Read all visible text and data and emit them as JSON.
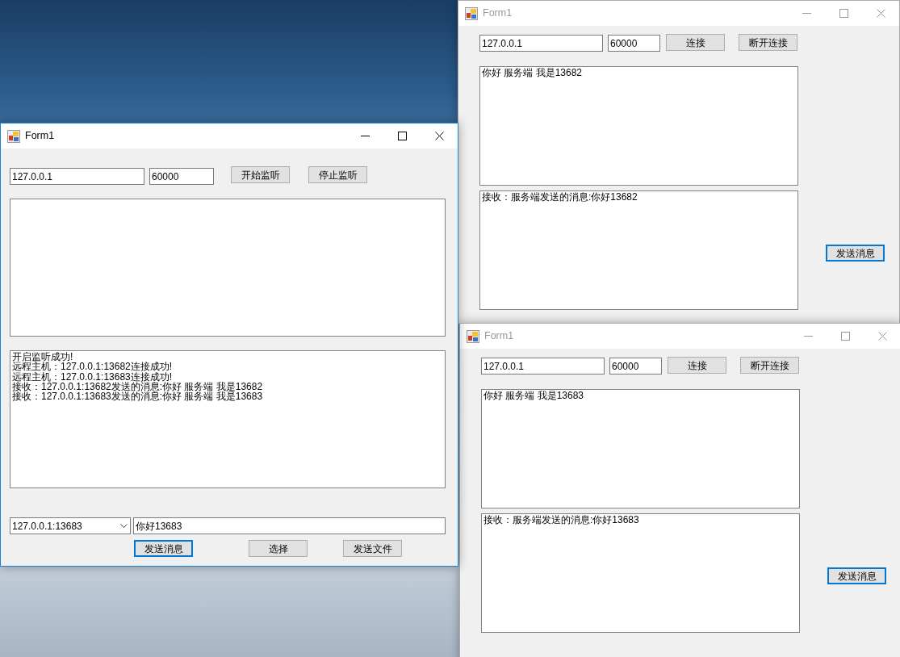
{
  "server_window": {
    "title": "Form1",
    "active": true,
    "ip": "127.0.0.1",
    "port": "60000",
    "buttons": [
      {
        "label": "开始监听",
        "focused": false
      },
      {
        "label": "停止监听",
        "focused": false
      }
    ],
    "log": [
      "开启监听成功!",
      "远程主机：127.0.0.1:13682连接成功!",
      "远程主机：127.0.0.1:13683连接成功!",
      "接收：127.0.0.1:13682发送的消息:你好 服务端 我是13682",
      "接收：127.0.0.1:13683发送的消息:你好 服务端 我是13683"
    ],
    "client_select": "127.0.0.1:13683",
    "message": "你好13683",
    "bottom_buttons": [
      {
        "label": "发送消息",
        "focused": true
      },
      {
        "label": "选择",
        "focused": false
      },
      {
        "label": "发送文件",
        "focused": false
      }
    ]
  },
  "client_windows": [
    {
      "title": "Form1",
      "active": false,
      "ip": "127.0.0.1",
      "port": "60000",
      "buttons": [
        {
          "label": "连接",
          "focused": false
        },
        {
          "label": "断开连接",
          "focused": false
        }
      ],
      "sent_text": "你好 服务端 我是13682",
      "received_text": "接收：服务端发送的消息:你好13682",
      "send_button": {
        "label": "发送消息",
        "focused": true
      }
    },
    {
      "title": "Form1",
      "active": false,
      "ip": "127.0.0.1",
      "port": "60000",
      "buttons": [
        {
          "label": "连接",
          "focused": false
        },
        {
          "label": "断开连接",
          "focused": false
        }
      ],
      "sent_text": "你好 服务端 我是13683",
      "received_text": "接收：服务端发送的消息:你好13683",
      "send_button": {
        "label": "发送消息",
        "focused": true
      }
    }
  ]
}
